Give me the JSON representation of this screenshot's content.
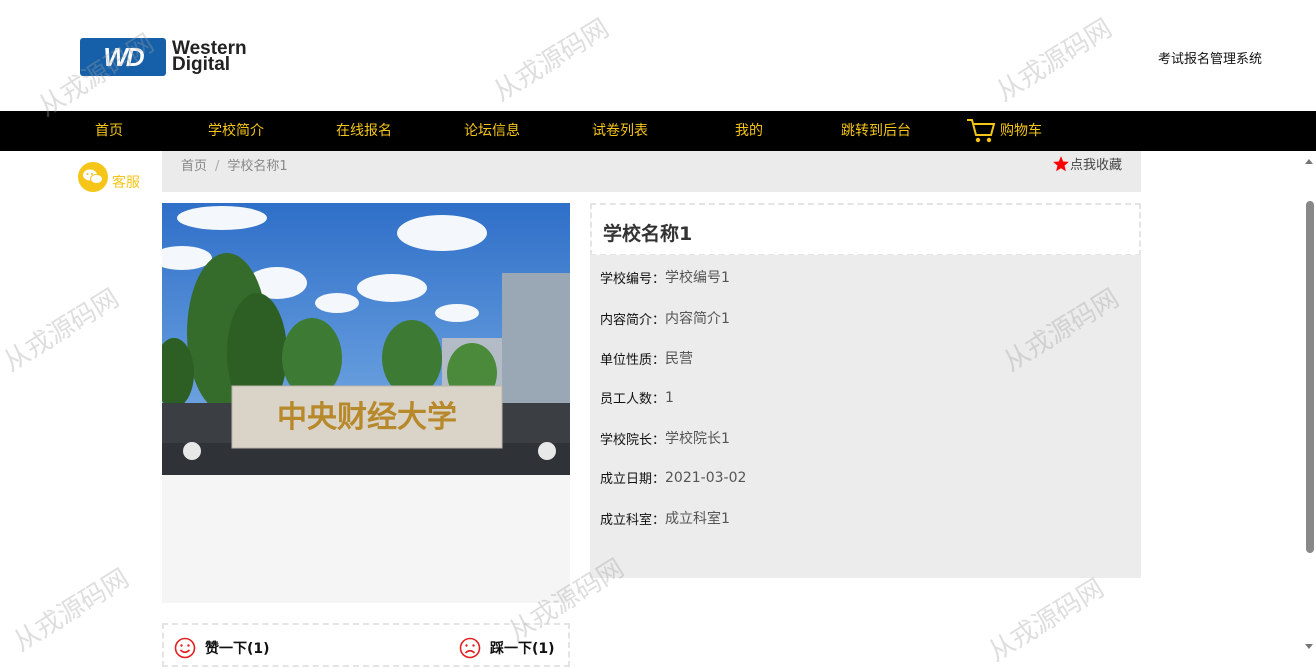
{
  "header": {
    "logo_text_line1": "Western",
    "logo_text_line2": "Digital",
    "logo_mark": "WD",
    "system_title": "考试报名管理系统"
  },
  "nav": {
    "items": [
      {
        "label": "首页"
      },
      {
        "label": "学校简介"
      },
      {
        "label": "在线报名"
      },
      {
        "label": "论坛信息"
      },
      {
        "label": "试卷列表"
      },
      {
        "label": "我的"
      },
      {
        "label": "跳转到后台"
      },
      {
        "label": "购物车",
        "icon": "cart-icon"
      }
    ]
  },
  "service": {
    "label": "客服",
    "icon": "wechat-icon"
  },
  "breadcrumb": {
    "home": "首页",
    "separator": "/",
    "current": "学校名称1"
  },
  "favorite": {
    "label": "点我收藏",
    "icon": "star-icon"
  },
  "photo": {
    "caption": "中央财经大学"
  },
  "detail": {
    "title": "学校名称1",
    "fields": [
      {
        "label": "学校编号：",
        "value": "学校编号1"
      },
      {
        "label": "内容简介：",
        "value": "内容简介1"
      },
      {
        "label": "单位性质：",
        "value": "民营"
      },
      {
        "label": "员工人数：",
        "value": "1"
      },
      {
        "label": "学校院长：",
        "value": "学校院长1"
      },
      {
        "label": "成立日期：",
        "value": "2021-03-02"
      },
      {
        "label": "成立科室：",
        "value": "成立科室1"
      }
    ]
  },
  "votes": {
    "like_label": "赞一下(1)",
    "dislike_label": "踩一下(1)"
  },
  "watermark": {
    "text": "从戎源码网"
  },
  "colors": {
    "accent": "#f5c518",
    "nav_bg": "#000000",
    "logo_blue": "#1560a8",
    "vote_red": "#e02020",
    "fav_star": "#ff0000"
  }
}
